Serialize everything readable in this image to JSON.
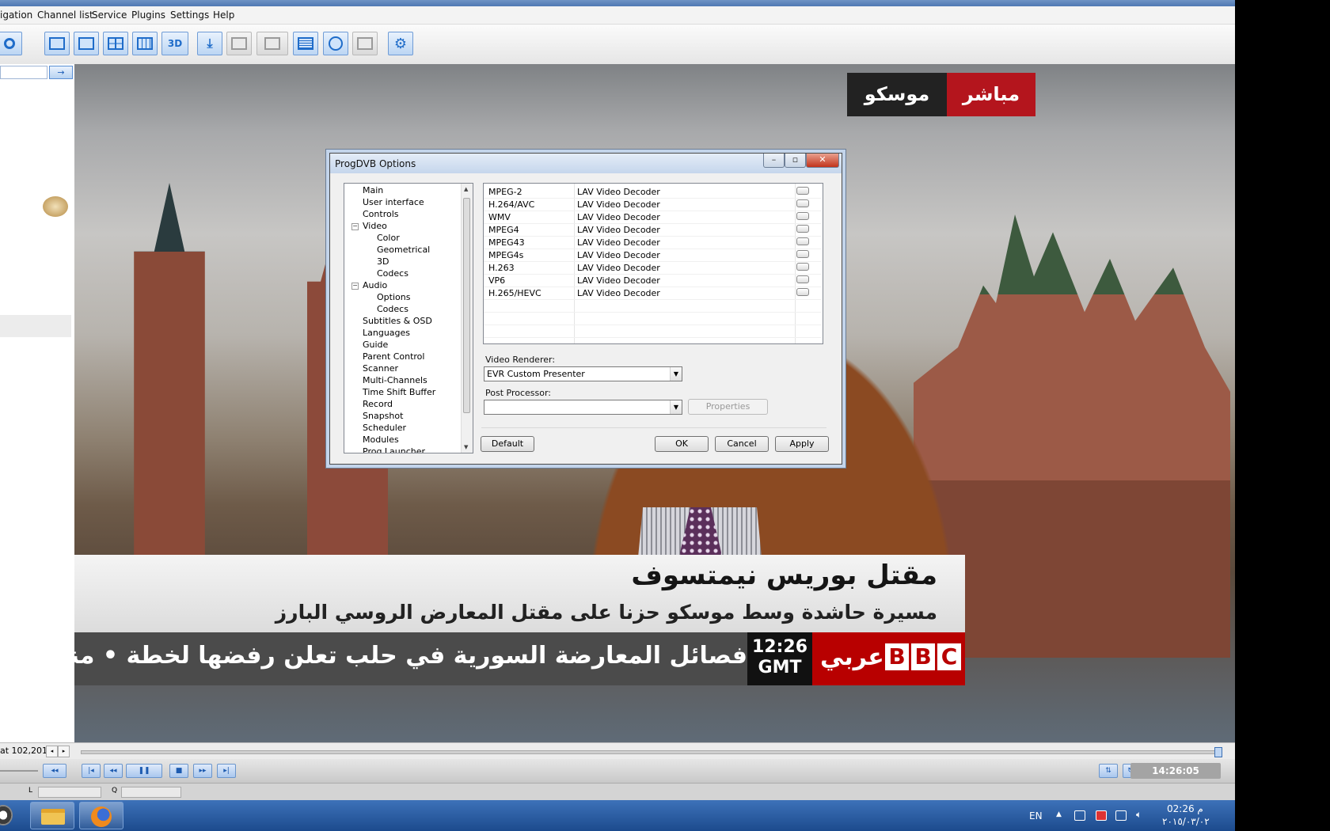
{
  "menu": [
    "igation",
    "Channel list",
    "Service",
    "Plugins",
    "Settings",
    "Help"
  ],
  "toolbar": {
    "buttons": [
      {
        "icon": "search-icon"
      },
      {
        "icon": "window-icon"
      },
      {
        "icon": "window-small-icon"
      },
      {
        "icon": "grid-4-icon"
      },
      {
        "icon": "grid-9-icon"
      },
      {
        "icon": "3d-icon",
        "label": "3D"
      },
      {
        "icon": "download-icon"
      },
      {
        "icon": "screen-icon"
      },
      {
        "icon": "subtitle-icon"
      },
      {
        "icon": "list-icon"
      },
      {
        "icon": "clock-icon"
      },
      {
        "icon": "record-icon"
      },
      {
        "icon": "settings-icon"
      }
    ]
  },
  "video": {
    "live_badge": {
      "place": "موسكو",
      "live": "مباشر"
    },
    "headline": "مقتل بوريس نيمتسوف",
    "subline": "مسيرة حاشدة وسط موسكو حزنا على مقتل المعارض الروسي البارز",
    "ticker": "لخطة رفضها تعلن حلب في السورية المعارضة فصائل  •  منها '",
    "ticker_display": "فصائل المعارضة السورية في حلب تعلن رفضها لخطة  •  منها '",
    "clock_time": "12:26",
    "clock_zone": "GMT",
    "channel_arabic": "عربي",
    "channel_letters": [
      "B",
      "B",
      "C"
    ]
  },
  "dialog": {
    "title": "ProgDVB Options",
    "tree": [
      {
        "label": "Main",
        "level": 0
      },
      {
        "label": "User interface",
        "level": 0
      },
      {
        "label": "Controls",
        "level": 0
      },
      {
        "label": "Video",
        "level": 0,
        "expand": "−"
      },
      {
        "label": "Color",
        "level": 1
      },
      {
        "label": "Geometrical",
        "level": 1
      },
      {
        "label": "3D",
        "level": 1
      },
      {
        "label": "Codecs",
        "level": 1
      },
      {
        "label": "Audio",
        "level": 0,
        "expand": "−"
      },
      {
        "label": "Options",
        "level": 1
      },
      {
        "label": "Codecs",
        "level": 1
      },
      {
        "label": "Subtitles & OSD",
        "level": 0
      },
      {
        "label": "Languages",
        "level": 0
      },
      {
        "label": "Guide",
        "level": 0
      },
      {
        "label": "Parent Control",
        "level": 0
      },
      {
        "label": "Scanner",
        "level": 0
      },
      {
        "label": "Multi-Channels",
        "level": 0
      },
      {
        "label": "Time Shift Buffer",
        "level": 0
      },
      {
        "label": "Record",
        "level": 0
      },
      {
        "label": "Snapshot",
        "level": 0
      },
      {
        "label": "Scheduler",
        "level": 0
      },
      {
        "label": "Modules",
        "level": 0
      },
      {
        "label": "Prog Launcher",
        "level": 0
      }
    ],
    "codecs": [
      {
        "name": "MPEG-2",
        "decoder": "LAV Video Decoder"
      },
      {
        "name": "H.264/AVC",
        "decoder": "LAV Video Decoder"
      },
      {
        "name": "WMV",
        "decoder": "LAV Video Decoder"
      },
      {
        "name": "MPEG4",
        "decoder": "LAV Video Decoder"
      },
      {
        "name": "MPEG43",
        "decoder": "LAV Video Decoder"
      },
      {
        "name": "MPEG4s",
        "decoder": "LAV Video Decoder"
      },
      {
        "name": "H.263",
        "decoder": "LAV Video Decoder"
      },
      {
        "name": "VP6",
        "decoder": "LAV Video Decoder"
      },
      {
        "name": "H.265/HEVC",
        "decoder": "LAV Video Decoder"
      }
    ],
    "video_renderer_label": "Video Renderer:",
    "video_renderer_value": "EVR Custom Presenter",
    "post_processor_label": "Post Processor:",
    "post_processor_value": "",
    "properties_label": "Properties",
    "default_label": "Default",
    "ok_label": "OK",
    "cancel_label": "Cancel",
    "apply_label": "Apply"
  },
  "status": {
    "left_text": "at 102,201,",
    "time": "14:26:05"
  },
  "volume": {
    "left_label": "L",
    "right_label": "Q"
  },
  "taskbar": {
    "language": "EN",
    "clock_time": "02:26 م",
    "clock_date": "٢٠١٥/٠٣/٠٢"
  },
  "colors": {
    "accent": "#1f6cc9",
    "bbc_red": "#b80000",
    "live_red": "#b4151d"
  }
}
